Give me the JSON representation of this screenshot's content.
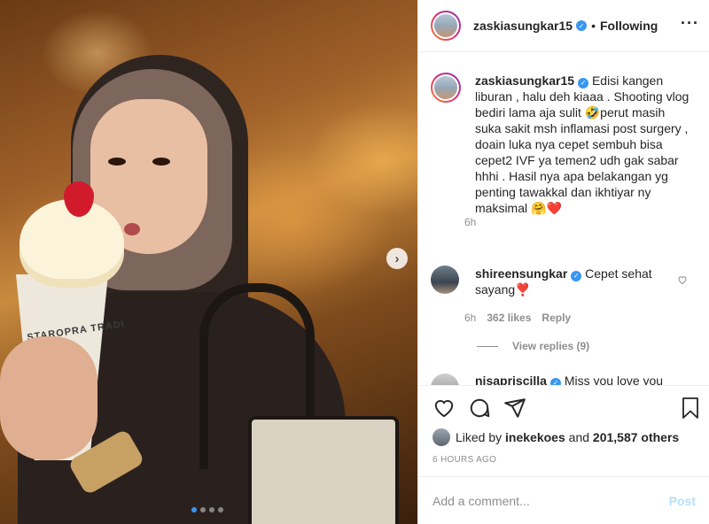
{
  "post": {
    "image_label": "STAROPRA TRADI",
    "carousel_dots": 4,
    "active_dot": 0
  },
  "header": {
    "username": "zaskiasungkar15",
    "separator": "•",
    "follow_status": "Following",
    "more_icon": "more-horizontal-icon"
  },
  "caption": {
    "username": "zaskiasungkar15",
    "text": "Edisi kangen liburan , halu deh kiaaa . Shooting vlog bediri lama aja sulit 🤣perut masih suka sakit msh inflamasi post surgery , doain luka nya cepet sembuh bisa cepet2 IVF ya temen2 udh gak sabar hhhi . Hasil nya apa belakangan yg penting tawakkal dan ikhtiyar ny maksimal 🤗❤️",
    "time": "6h"
  },
  "comments": [
    {
      "username": "shireensungkar",
      "text": "Cepet sehat sayang❣️",
      "time": "6h",
      "likes": "362 likes",
      "reply": "Reply"
    },
    {
      "username": "nisapriscilla",
      "text": "Miss you love you"
    }
  ],
  "view_replies": "View replies (9)",
  "likes": {
    "prefix": "Liked by",
    "user": "inekekoes",
    "middle": "and",
    "count": "201,587 others"
  },
  "post_time": "6 HOURS AGO",
  "comment_input": {
    "placeholder": "Add a comment...",
    "post_label": "Post"
  },
  "colors": {
    "verified": "#3897f0",
    "muted": "#8e8e8e",
    "post_disabled": "#b2dffc",
    "text": "#262626"
  }
}
